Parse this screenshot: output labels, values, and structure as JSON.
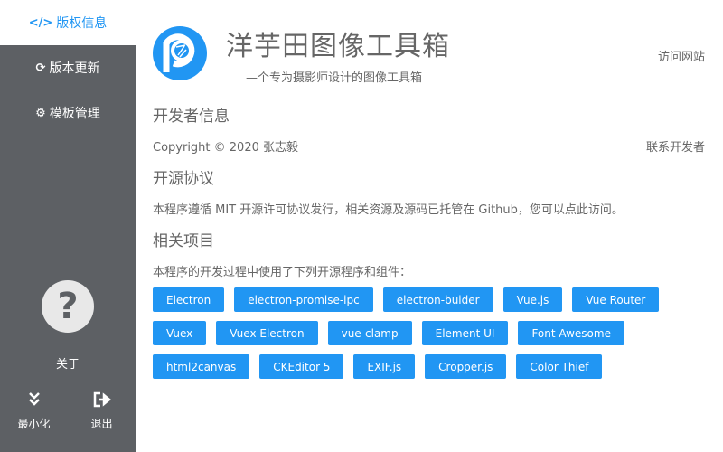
{
  "sidebar": {
    "nav": [
      {
        "label": "版权信息",
        "icon": "code-icon",
        "icon_glyph": "</>",
        "active": true
      },
      {
        "label": "版本更新",
        "icon": "sync-icon",
        "icon_glyph": "⟳",
        "active": false
      },
      {
        "label": "模板管理",
        "icon": "gear-icon",
        "icon_glyph": "⚙",
        "active": false
      }
    ],
    "about": {
      "label": "关于",
      "icon": "question-circle-icon",
      "icon_glyph": "?"
    },
    "minimize": {
      "label": "最小化",
      "icon": "double-chevron-down-icon",
      "icon_glyph": "⌄"
    },
    "exit": {
      "label": "退出",
      "icon": "sign-out-icon",
      "icon_glyph": "➜"
    }
  },
  "header": {
    "title": "洋芋田图像工具箱",
    "subtitle": "—个专为摄影师设计的图像工具箱",
    "visit_link": "访问网站"
  },
  "developer": {
    "heading": "开发者信息",
    "copyright": "Copyright © 2020 张志毅",
    "contact_link": "联系开发者"
  },
  "license": {
    "heading": "开源协议",
    "text": "本程序遵循 MIT 开源许可协议发行，相关资源及源码已托管在 Github，您可以点此访问。"
  },
  "projects": {
    "heading": "相关项目",
    "text": "本程序的开发过程中使用了下列开源程序和组件：",
    "tags": [
      "Electron",
      "electron-promise-ipc",
      "electron-buider",
      "Vue.js",
      "Vue Router",
      "Vuex",
      "Vuex Electron",
      "vue-clamp",
      "Element UI",
      "Font Awesome",
      "html2canvas",
      "CKEditor 5",
      "EXIF.js",
      "Cropper.js",
      "Color Thief"
    ]
  },
  "colors": {
    "sidebar_bg": "#5d6064",
    "accent": "#2196f3",
    "text": "#666666"
  }
}
